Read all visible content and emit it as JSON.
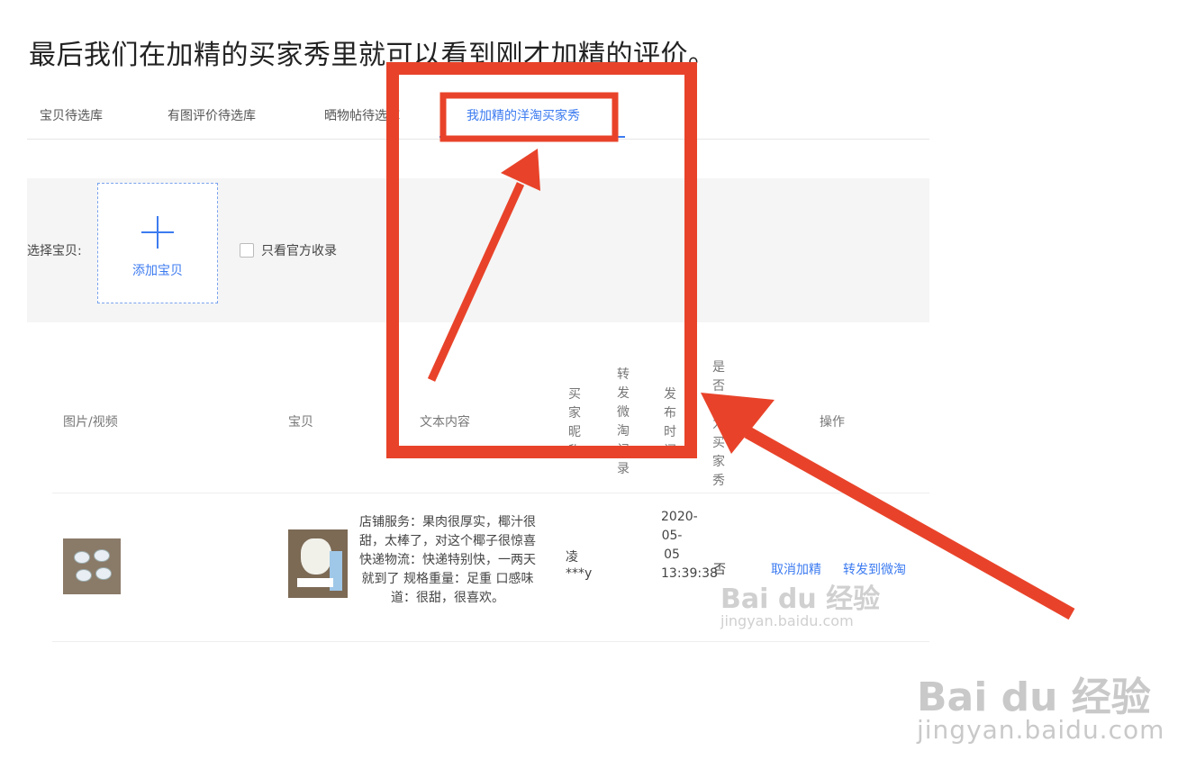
{
  "caption": "最后我们在加精的买家秀里就可以看到刚才加精的评价。",
  "tabs": [
    {
      "label": "宝贝待选库"
    },
    {
      "label": "有图评价待选库"
    },
    {
      "label": "晒物帖待选库"
    },
    {
      "label": "我加精的洋淘买家秀"
    }
  ],
  "filter": {
    "select_label": "选择宝贝:",
    "add_label": "添加宝贝",
    "official_only_label": "只看官方收录"
  },
  "table": {
    "headers": {
      "media": "图片/视频",
      "item": "宝贝",
      "text": "文本内容",
      "nickname": "买家昵称",
      "weitao": "转发微淘记录",
      "time": "发布时间",
      "is_show": "是否设为买家秀",
      "ops": "操作"
    },
    "row": {
      "text": "店铺服务：果肉很厚实，椰汁很甜，太棒了，对这个椰子很惊喜 快递物流：快递特别快，一两天就到了 规格重量：足重 口感味道：很甜，很喜欢。",
      "nickname": "凌***y",
      "time": "2020-05-05 13:39:38",
      "is_show": "否",
      "op_cancel": "取消加精",
      "op_forward": "转发到微淘"
    }
  },
  "watermark": {
    "brand": "Bai du 经验",
    "url": "jingyan.baidu.com"
  },
  "colors": {
    "accent": "#3c7bf0",
    "annotation": "#e8432a"
  }
}
